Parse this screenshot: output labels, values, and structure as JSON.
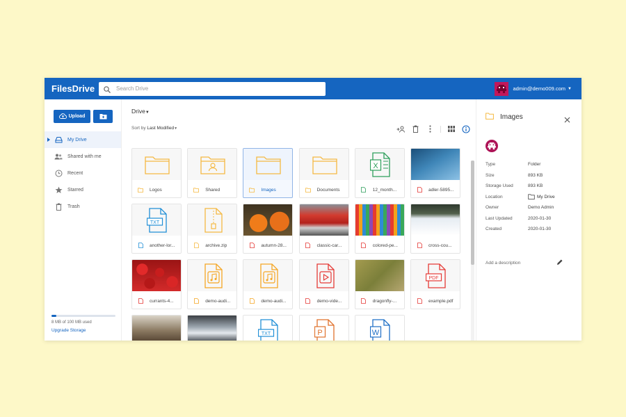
{
  "header": {
    "logo": "FilesDrive",
    "search_placeholder": "Search Drive",
    "account": "admin@demo009.com"
  },
  "sidebar": {
    "upload_label": "Upload",
    "items": [
      {
        "label": "My Drive",
        "icon": "drive-icon"
      },
      {
        "label": "Shared with me",
        "icon": "people-icon"
      },
      {
        "label": "Recent",
        "icon": "clock-icon"
      },
      {
        "label": "Starred",
        "icon": "star-icon"
      },
      {
        "label": "Trash",
        "icon": "trash-icon"
      }
    ],
    "storage_text": "8 MB of 100 MB used",
    "storage_fraction": 0.08,
    "upgrade_label": "Upgrade Storage"
  },
  "main": {
    "breadcrumb": "Drive",
    "sort_prefix": "Sort by",
    "sort_value": "Last Modified",
    "items": [
      {
        "name": "Logos",
        "kind": "folder"
      },
      {
        "name": "Shared",
        "kind": "folder-shared"
      },
      {
        "name": "Images",
        "kind": "folder",
        "selected": true
      },
      {
        "name": "Documents",
        "kind": "folder"
      },
      {
        "name": "12_month...",
        "kind": "excel"
      },
      {
        "name": "adler-5895...",
        "kind": "image-eagle"
      },
      {
        "name": "another-lor...",
        "kind": "txt"
      },
      {
        "name": "archive.zip",
        "kind": "zip"
      },
      {
        "name": "autumn-28...",
        "kind": "image-pumpkins"
      },
      {
        "name": "classic-car...",
        "kind": "image-car"
      },
      {
        "name": "colored-pe...",
        "kind": "image-pencils"
      },
      {
        "name": "cross-cou...",
        "kind": "image-snow"
      },
      {
        "name": "currants-4...",
        "kind": "image-currants"
      },
      {
        "name": "demo-audi...",
        "kind": "audio"
      },
      {
        "name": "demo-audi...",
        "kind": "audio"
      },
      {
        "name": "demo-vide...",
        "kind": "video"
      },
      {
        "name": "dragonfly-...",
        "kind": "image-dragonfly"
      },
      {
        "name": "example.pdf",
        "kind": "pdf"
      },
      {
        "name": "",
        "kind": "image-bird"
      },
      {
        "name": "",
        "kind": "image-ice"
      },
      {
        "name": "",
        "kind": "txt"
      },
      {
        "name": "",
        "kind": "ppt"
      },
      {
        "name": "",
        "kind": "word"
      }
    ]
  },
  "details": {
    "title": "Images",
    "props": [
      {
        "k": "Type",
        "v": "Folder"
      },
      {
        "k": "Size",
        "v": "893 KB"
      },
      {
        "k": "Storage Used",
        "v": "893 KB"
      },
      {
        "k": "Location",
        "v": "My Drive"
      },
      {
        "k": "Owner",
        "v": "Demo Admin"
      },
      {
        "k": "Last Updated",
        "v": "2020-01-30"
      },
      {
        "k": "Created",
        "v": "2020-01-30"
      }
    ],
    "description_placeholder": "Add a description"
  },
  "colors": {
    "brand": "#1565c0",
    "folder": "#f5b942",
    "background": "#fdf8c8"
  }
}
